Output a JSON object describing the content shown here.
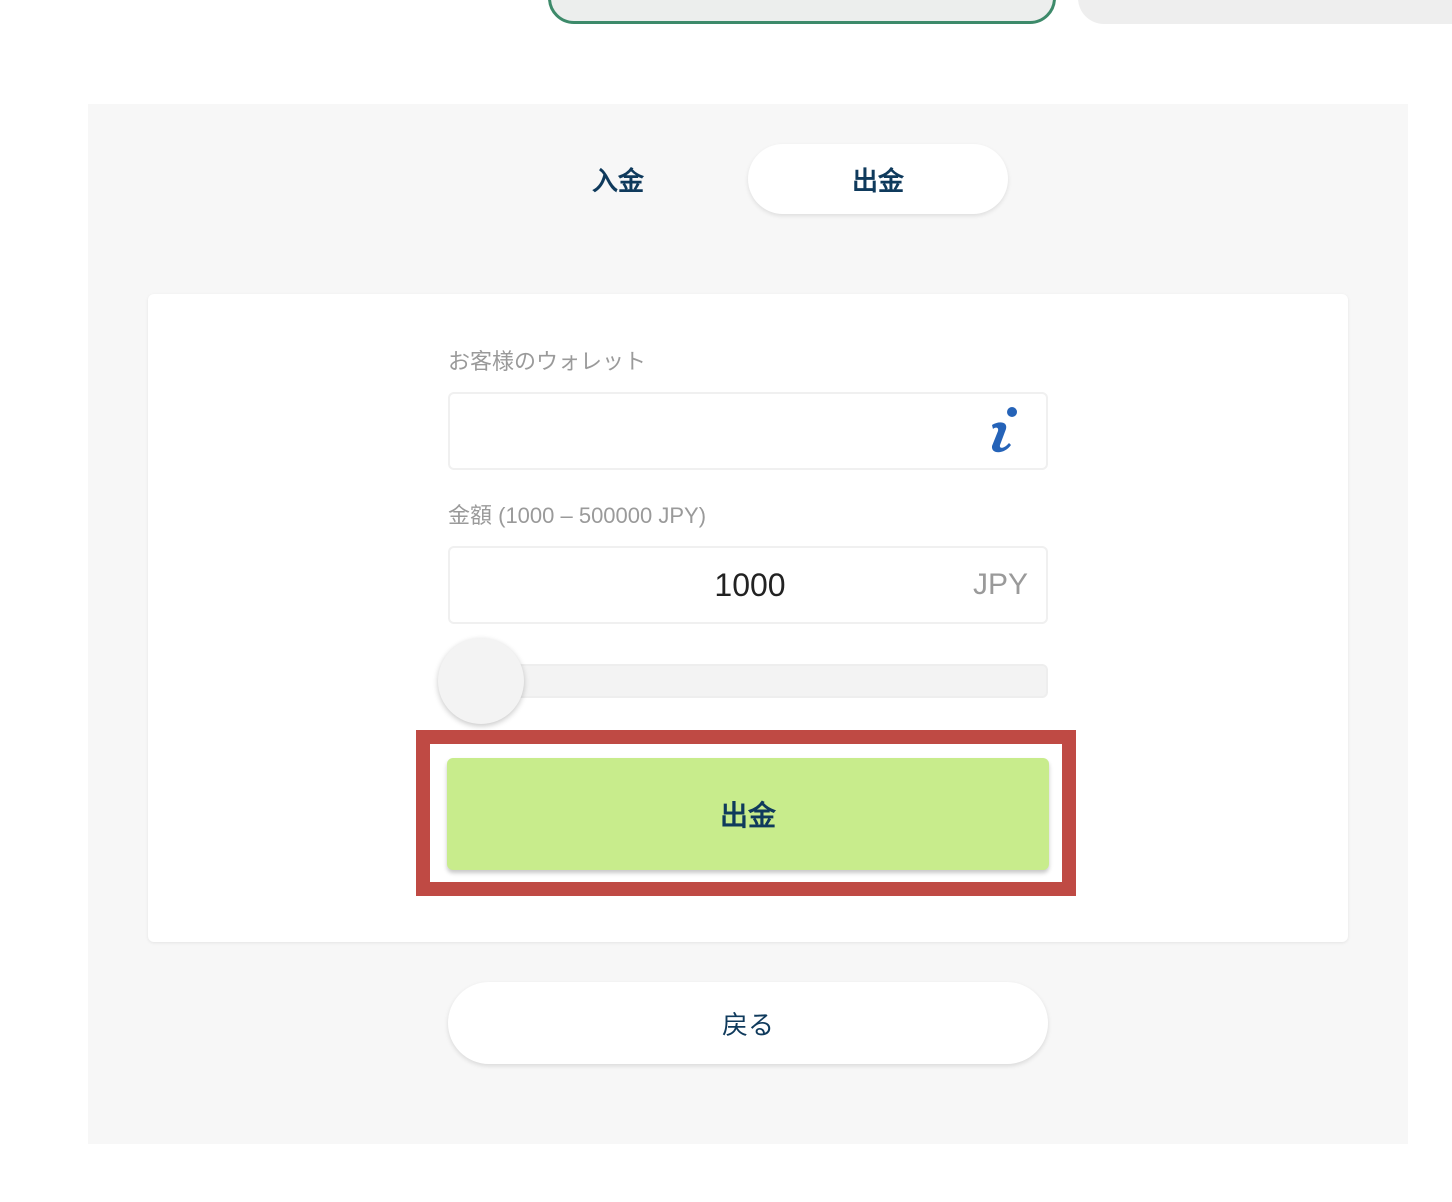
{
  "tabs": {
    "deposit_label": "入金",
    "withdraw_label": "出金",
    "active": "withdraw"
  },
  "form": {
    "wallet_label": "お客様のウォレット",
    "wallet_value": "",
    "amount_label": "金額 (1000 – 500000 JPY)",
    "amount_value": "1000",
    "currency": "JPY",
    "slider": {
      "min": 1000,
      "max": 500000,
      "value": 1000
    }
  },
  "buttons": {
    "withdraw_label": "出金",
    "back_label": "戻る"
  },
  "icons": {
    "wallet_info": "info-icon"
  },
  "colors": {
    "accent_green": "#c8ec8c",
    "text_navy": "#0f3a5c",
    "highlight_red": "#bf4a44",
    "tab_border_green": "#3d8a6a"
  }
}
